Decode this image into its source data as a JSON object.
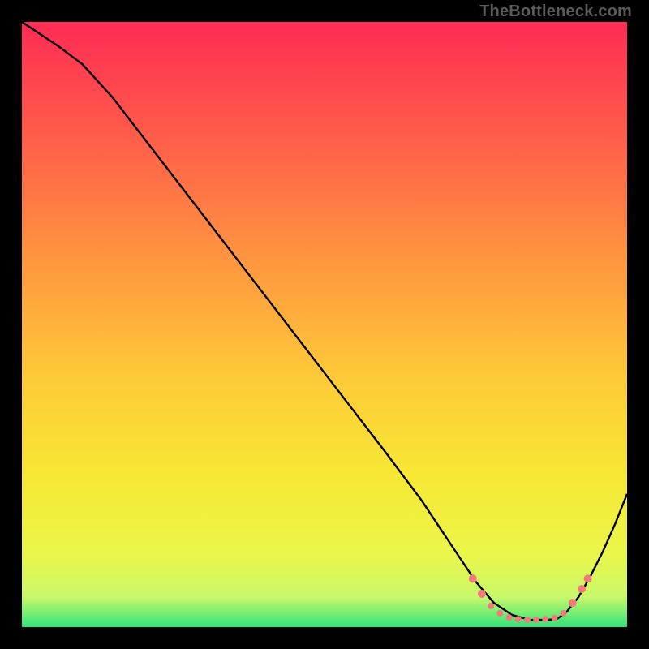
{
  "attribution": "TheBottleneck.com",
  "colors": {
    "frame": "#000000",
    "curve": "#000000",
    "markers": "#ef7b7b",
    "gradient_stops": [
      {
        "offset": "0%",
        "color": "#ff2b55"
      },
      {
        "offset": "18%",
        "color": "#ff5a4a"
      },
      {
        "offset": "38%",
        "color": "#ff9240"
      },
      {
        "offset": "58%",
        "color": "#ffc838"
      },
      {
        "offset": "75%",
        "color": "#f7e834"
      },
      {
        "offset": "88%",
        "color": "#eaf64a"
      },
      {
        "offset": "95%",
        "color": "#c9f86a"
      },
      {
        "offset": "100%",
        "color": "#2fe47a"
      }
    ]
  },
  "chart_data": {
    "type": "line",
    "title": "",
    "xlabel": "",
    "ylabel": "",
    "xlim": [
      0,
      100
    ],
    "ylim": [
      0,
      100
    ],
    "series": [
      {
        "name": "bottleneck-curve",
        "x": [
          0,
          3,
          6,
          10,
          15,
          20,
          25,
          30,
          35,
          40,
          45,
          50,
          55,
          60,
          63,
          66,
          69,
          72,
          75,
          78,
          81,
          84,
          87,
          88.5,
          90,
          92,
          94,
          96,
          98,
          100
        ],
        "y": [
          100,
          98,
          96,
          93,
          87.5,
          81,
          74.5,
          68,
          61.5,
          55,
          48.5,
          42,
          35.5,
          29,
          25,
          21,
          16.5,
          12,
          7.5,
          4,
          2,
          1.2,
          1.2,
          1.4,
          2.5,
          5,
          8.5,
          12.5,
          17,
          22
        ]
      }
    ],
    "markers": {
      "name": "optimal-zone",
      "color": "#ef7b7b",
      "points": [
        {
          "x": 74.5,
          "y": 8.0,
          "r": 5
        },
        {
          "x": 76.0,
          "y": 5.5,
          "r": 5
        },
        {
          "x": 77.5,
          "y": 3.5,
          "r": 4
        },
        {
          "x": 79.0,
          "y": 2.3,
          "r": 4
        },
        {
          "x": 80.5,
          "y": 1.6,
          "r": 4
        },
        {
          "x": 82.0,
          "y": 1.3,
          "r": 4
        },
        {
          "x": 83.5,
          "y": 1.2,
          "r": 4
        },
        {
          "x": 85.0,
          "y": 1.2,
          "r": 4
        },
        {
          "x": 86.5,
          "y": 1.3,
          "r": 4
        },
        {
          "x": 88.0,
          "y": 1.5,
          "r": 4
        },
        {
          "x": 89.5,
          "y": 2.3,
          "r": 4
        },
        {
          "x": 91.0,
          "y": 4.0,
          "r": 5
        },
        {
          "x": 92.5,
          "y": 6.3,
          "r": 5
        },
        {
          "x": 93.5,
          "y": 8.0,
          "r": 5
        }
      ]
    }
  }
}
